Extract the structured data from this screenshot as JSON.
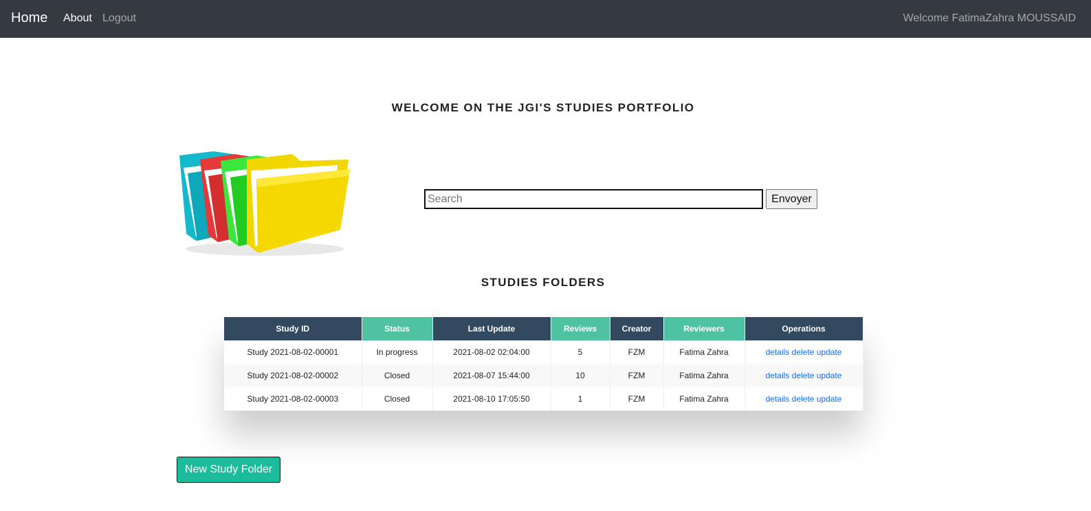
{
  "navbar": {
    "brand": "Home",
    "about": "About",
    "logout": "Logout",
    "welcome": "Welcome FatimaZahra MOUSSAID"
  },
  "main": {
    "title": "WELCOME ON THE JGI'S STUDIES PORTFOLIO",
    "folders_image": "folders-illustration",
    "search": {
      "placeholder": "Search",
      "value": "",
      "button": "Envoyer"
    },
    "section_title": "STUDIES FOLDERS",
    "new_study_button": "New Study Folder"
  },
  "table": {
    "headers": [
      "Study ID",
      "Status",
      "Last Update",
      "Reviews",
      "Creator",
      "Reviewers",
      "Operations"
    ],
    "rows": [
      {
        "id": "Study 2021-08-02-00001",
        "status": "In progress",
        "last_update": "2021-08-02 02:04:00",
        "reviews": "5",
        "creator": "FZM",
        "reviewers": "Fatima Zahra",
        "details": "details",
        "delete": "delete",
        "update": "update"
      },
      {
        "id": "Study 2021-08-02-00002",
        "status": "Closed",
        "last_update": "2021-08-07 15:44:00",
        "reviews": "10",
        "creator": "FZM",
        "reviewers": "Fatima Zahra",
        "details": "details",
        "delete": "delete",
        "update": "update"
      },
      {
        "id": "Study 2021-08-02-00003",
        "status": "Closed",
        "last_update": "2021-08-10 17:05:50",
        "reviews": "1",
        "creator": "FZM",
        "reviewers": "Fatima Zahra",
        "details": "details",
        "delete": "delete",
        "update": "update"
      }
    ]
  },
  "colors": {
    "navbar": "#343a40",
    "header_dark": "#324960",
    "header_teal": "#4fc3a1",
    "link": "#0d6efd",
    "button": "#1abc9c"
  }
}
